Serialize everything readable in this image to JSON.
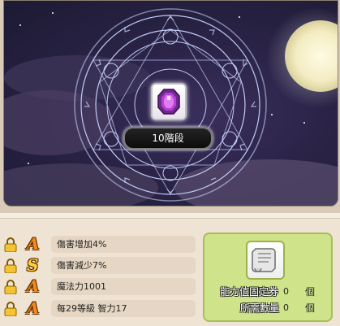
{
  "cube": {
    "grade_label": "10階段",
    "gem_icon": "purple-gem-icon"
  },
  "potential_lines": [
    {
      "rank": "A",
      "rank_color": "#f28a1e",
      "text": "傷害增加4%",
      "lock_icon": "lock-icon"
    },
    {
      "rank": "S",
      "rank_color": "#ffd23a",
      "text": "傷害減少7%",
      "lock_icon": "lock-icon"
    },
    {
      "rank": "A",
      "rank_color": "#f28a1e",
      "text": "魔法力1001",
      "lock_icon": "lock-icon"
    },
    {
      "rank": "A",
      "rank_color": "#f28a1e",
      "text": "每29等級  智力17",
      "lock_icon": "lock-icon"
    }
  ],
  "lock_panel": {
    "scroll_icon": "scroll-icon",
    "ticket_label": "能力值固定券",
    "ticket_value": "0",
    "ticket_unit": "個",
    "required_label": "所需數量",
    "required_value": "0",
    "required_unit": "個"
  }
}
